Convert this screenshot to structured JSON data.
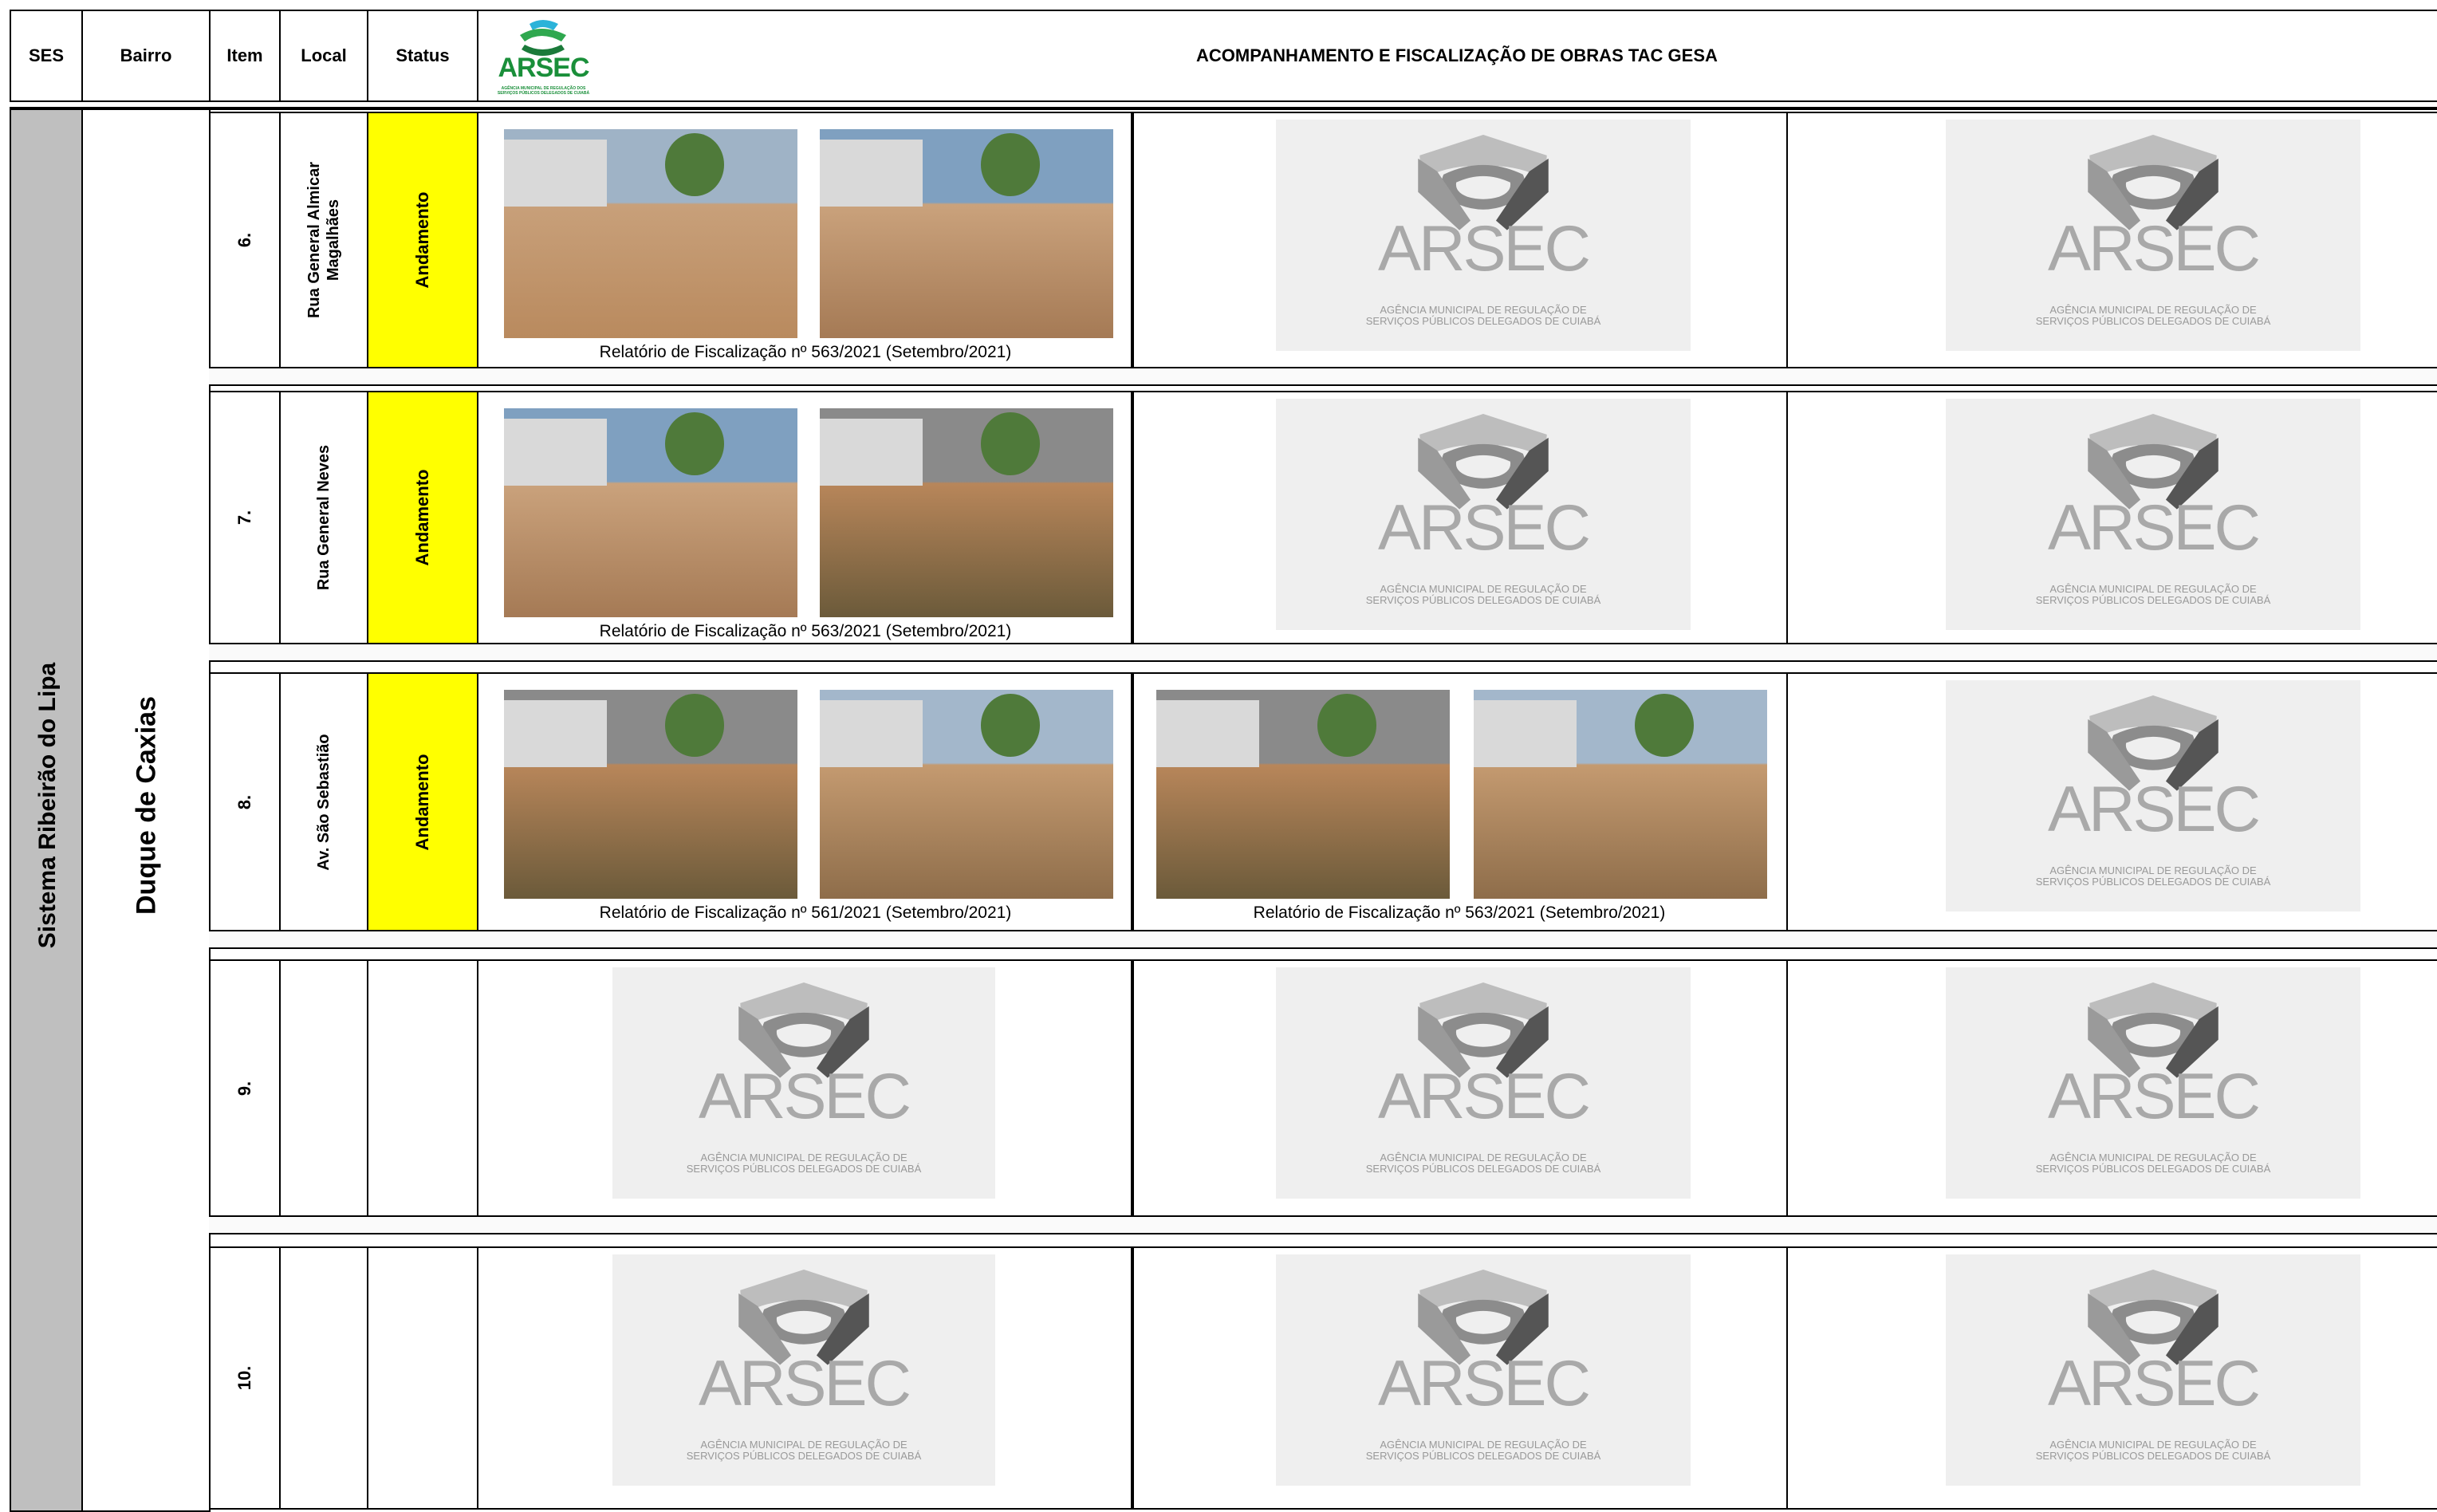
{
  "header": {
    "col_ses": "SES",
    "col_bairro": "Bairro",
    "col_item": "Item",
    "col_local": "Local",
    "col_status": "Status",
    "title": "ACOMPANHAMENTO E FISCALIZAÇÃO DE OBRAS TAC GESA",
    "logo_word": "ARSEC",
    "logo_sub": "AGÊNCIA MUNICIPAL DE REGULAÇÃO DOS SERVIÇOS PÚBLICOS DELEGADOS DE CUIABÁ"
  },
  "ses": "Sistema Ribeirão do Lipa",
  "bairro": "Duque de Caxias",
  "placeholder": {
    "word": "ARSEC",
    "line1": "AGÊNCIA MUNICIPAL DE REGULAÇÃO DE",
    "line2": "SERVIÇOS PÚBLICOS DELEGADOS DE CUIABÁ"
  },
  "rows": [
    {
      "item": "6.",
      "local_line1": "Rua General Almicar",
      "local_line2": "Magalhães",
      "status": "Andamento",
      "caption1": "Relatório de Fiscalização nº 563/2021 (Setembro/2021)",
      "caption2": ""
    },
    {
      "item": "7.",
      "local_line1": "Rua General Neves",
      "local_line2": "",
      "status": "Andamento",
      "caption1": "Relatório de Fiscalização nº 563/2021 (Setembro/2021)",
      "caption2": ""
    },
    {
      "item": "8.",
      "local_line1": "Av. São Sebastião",
      "local_line2": "",
      "status": "Andamento",
      "caption1": "Relatório de Fiscalização nº 561/2021 (Setembro/2021)",
      "caption2": "Relatório de Fiscalização nº 563/2021 (Setembro/2021)"
    },
    {
      "item": "9.",
      "local_line1": "",
      "local_line2": "",
      "status": "",
      "caption1": "",
      "caption2": ""
    },
    {
      "item": "10.",
      "local_line1": "",
      "local_line2": "",
      "status": "",
      "caption1": "",
      "caption2": ""
    }
  ],
  "colors": {
    "status_yellow": "#ffff00",
    "ses_gray": "#bfbfbf",
    "placeholder_bg": "#efefef"
  }
}
